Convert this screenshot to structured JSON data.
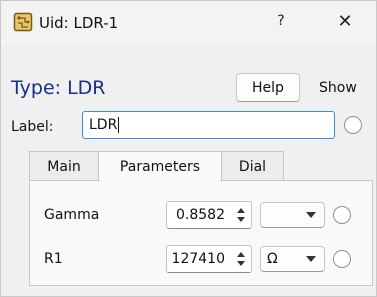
{
  "window": {
    "title": "Uid: LDR-1",
    "help_glyph": "?",
    "close_glyph": "✕",
    "app_icon": "component-board-icon"
  },
  "header": {
    "type_label": "Type: LDR",
    "help_button": "Help",
    "show_label": "Show"
  },
  "label_row": {
    "caption": "Label:",
    "value": "LDR"
  },
  "tabs": [
    {
      "label": "Main",
      "active": false
    },
    {
      "label": "Parameters",
      "active": true
    },
    {
      "label": "Dial",
      "active": false
    }
  ],
  "parameters": [
    {
      "name": "Gamma",
      "value": "0.8582",
      "unit": ""
    },
    {
      "name": "R1",
      "value": "127410",
      "unit": "Ω"
    }
  ],
  "colors": {
    "accent": "#3d8be1",
    "type_title": "#1a2f86"
  }
}
